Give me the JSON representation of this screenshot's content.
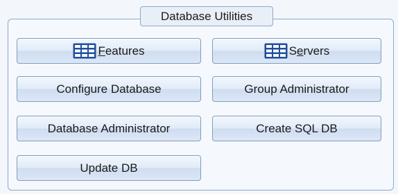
{
  "group": {
    "title": "Database Utilities"
  },
  "buttons": {
    "features": {
      "mnemonic": "F",
      "rest": "eatures",
      "icon": "table-grid-icon"
    },
    "servers": {
      "pre": "S",
      "mnemonic": "e",
      "rest": "rvers",
      "icon": "table-grid-icon"
    },
    "configure_database": "Configure Database",
    "group_administrator": "Group Administrator",
    "database_administrator": "Database Administrator",
    "create_sql_db": "Create SQL DB",
    "update_db": "Update DB"
  },
  "colors": {
    "icon_blue": "#1f4e9e",
    "border": "#7f9db9"
  }
}
